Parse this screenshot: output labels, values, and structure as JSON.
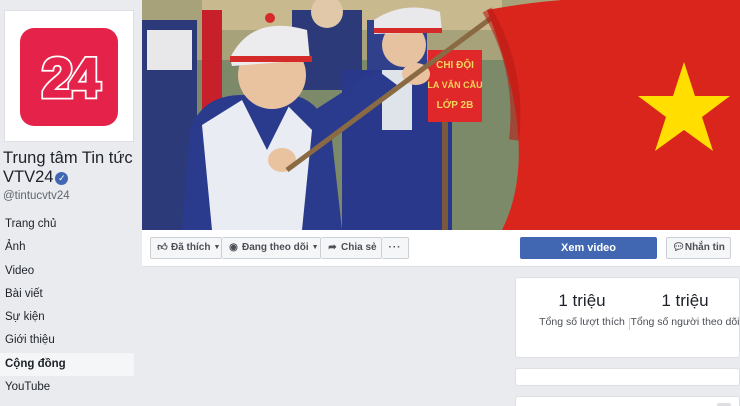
{
  "page": {
    "name": "Trung tâm Tin tức VTV24",
    "handle": "@tintucvtv24",
    "verified_icon": "verified-check-icon",
    "logo_text": "24"
  },
  "nav": [
    {
      "label": "Trang chủ",
      "active": false
    },
    {
      "label": "Ảnh",
      "active": false
    },
    {
      "label": "Video",
      "active": false
    },
    {
      "label": "Bài viết",
      "active": false
    },
    {
      "label": "Sự kiện",
      "active": false
    },
    {
      "label": "Giới thiệu",
      "active": false
    },
    {
      "label": "Cộng đồng",
      "active": true
    },
    {
      "label": "YouTube",
      "active": false
    }
  ],
  "cover": {
    "sign_line1": "CHI ĐỘI",
    "sign_line2": "LA VĂN CẦU",
    "sign_line3": "LỚP 2B"
  },
  "actions": {
    "liked": "Đã thích",
    "following": "Đang theo dõi",
    "share": "Chia sẻ",
    "more": "···",
    "watch_video": "Xem video",
    "message": "Nhắn tin"
  },
  "stats": {
    "likes_count": "1 triệu",
    "likes_label": "Tổng số lượt thích",
    "followers_count": "1 triệu",
    "followers_label": "Tổng số người theo dõi"
  },
  "colors": {
    "brand_blue": "#4267b2",
    "logo_red": "#e5234a",
    "flag_red": "#da251d",
    "flag_star": "#ffde00",
    "background": "#e9ebee"
  }
}
